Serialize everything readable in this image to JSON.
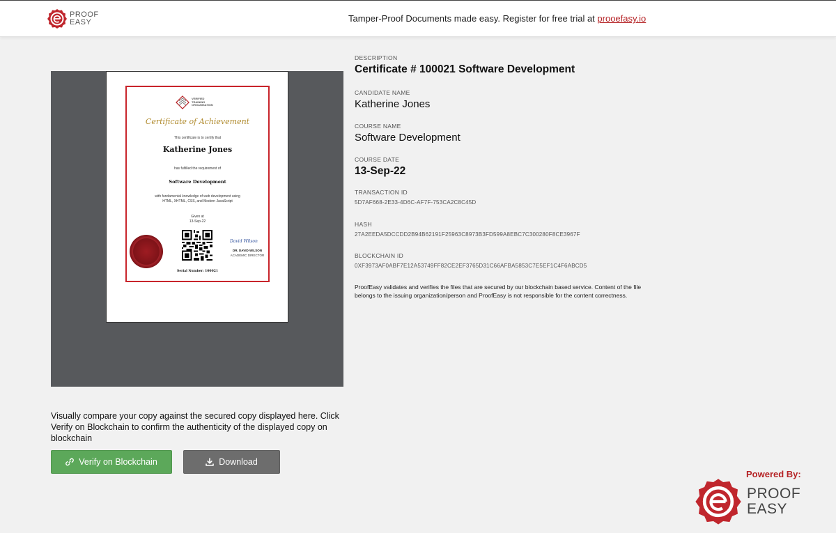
{
  "header": {
    "logo_line1": "PROOF",
    "logo_line2": "EASY",
    "message": "Tamper-Proof Documents made easy. Register for free trial at ",
    "link_text": "prooefasy.io"
  },
  "certificate": {
    "org_line1": "VERIFIED",
    "org_line2": "TRAINING",
    "org_line3": "ORGANISATION",
    "title": "Certificate of Achievement",
    "certify_text": "This certificate is to certify that",
    "name": "Katherine Jones",
    "fulfilled_text": "has fulfilled the requirement of",
    "course": "Software Development",
    "knowledge_line1": "with fundamental knowledge of web development using",
    "knowledge_line2": "HTML, XHTML, CSS, and Modern JavaScript",
    "given_at": "Given at",
    "date": "13-Sep-22",
    "signature": "David Wilson",
    "signer_name": "DR. DAVID WILSON",
    "signer_title": "ACADEMIC DIRECTOR",
    "serial": "Serial Number: 100021"
  },
  "details": {
    "description_label": "DESCRIPTION",
    "description": "Certificate # 100021 Software Development",
    "candidate_label": "CANDIDATE NAME",
    "candidate": "Katherine Jones",
    "course_label": "COURSE NAME",
    "course": "Software Development",
    "date_label": "COURSE DATE",
    "date": "13-Sep-22",
    "transaction_label": "TRANSACTION ID",
    "transaction": "5D7AF668-2E33-4D6C-AF7F-753CA2C8C45D",
    "hash_label": "HASH",
    "hash": "27A2EEDA5DCCDD2B94B62191F25963C8973B3FD599A8EBC7C300280F8CE3967F",
    "blockchain_label": "BLOCKCHAIN ID",
    "blockchain": "0XF3973AF0ABF7E12A53749FF82CE2EF3765D31C66AFBA5853C7E5EF1C4F6ABCD5",
    "disclaimer": "ProofEasy validates and verifies the files that are secured by our blockchain based service. Content of the file belongs to the issuing organization/person and ProofEasy is not responsible for the content correctness."
  },
  "compare": {
    "text": "Visually compare your copy against the secured copy displayed here. Click Verify on Blockchain to confirm the authenticity of the displayed copy on blockchain"
  },
  "buttons": {
    "verify": "Verify on Blockchain",
    "download": "Download"
  },
  "powered": {
    "label": "Powered By:",
    "line1": "PROOF",
    "line2": "EASY"
  },
  "colors": {
    "brand_red": "#b52225",
    "verify_green": "#5ca85a",
    "download_gray": "#6d6d6d",
    "viewer_bg": "#57595c"
  },
  "icons": [
    "proofeasy-logo-icon",
    "link-icon",
    "download-icon",
    "seal-icon",
    "qr-code-icon"
  ]
}
